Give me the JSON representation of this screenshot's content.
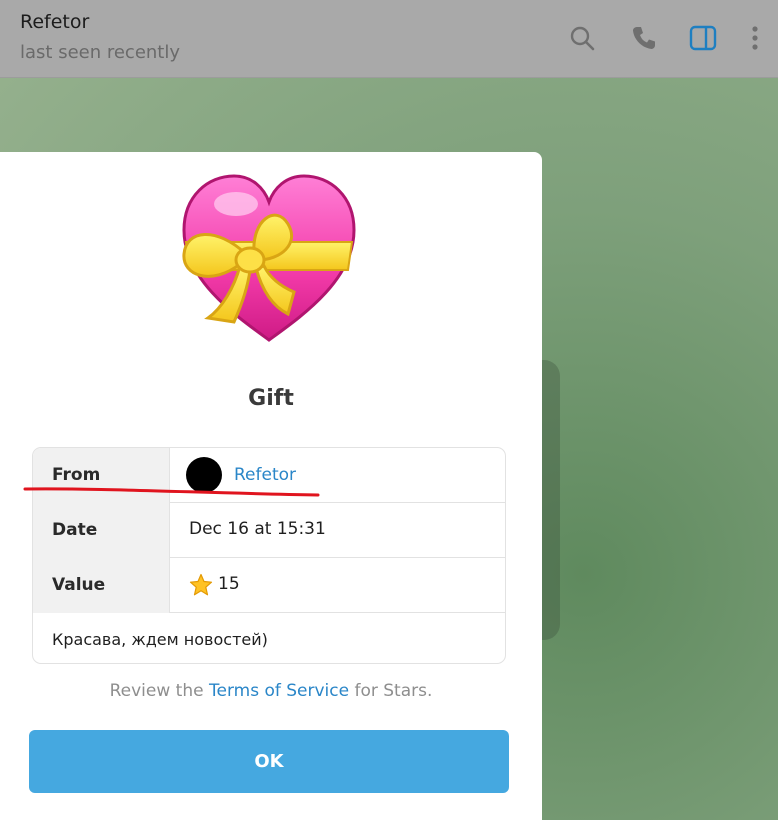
{
  "header": {
    "title": "Refetor",
    "status": "last seen recently",
    "icons": [
      "search-icon",
      "phone-icon",
      "sidebar-toggle-icon",
      "more-vertical-icon"
    ]
  },
  "gift": {
    "icon": "heart-with-ribbon-icon",
    "title": "Gift",
    "rows": [
      {
        "label": "From",
        "value": "Refetor",
        "icon": "avatar"
      },
      {
        "label": "Date",
        "value": "Dec 16 at 15:31"
      },
      {
        "label": "Value",
        "value": "15",
        "icon": "star-icon"
      }
    ],
    "comment": "Красава, ждем новостей)"
  },
  "terms": {
    "prefix": "Review the",
    "link": "Terms of Service",
    "suffix": "for Stars."
  },
  "actions": {
    "ok_label": "OK"
  },
  "colors": {
    "accent": "#45a8e0",
    "link": "#2a86c8",
    "annotation": "#e0141e"
  }
}
